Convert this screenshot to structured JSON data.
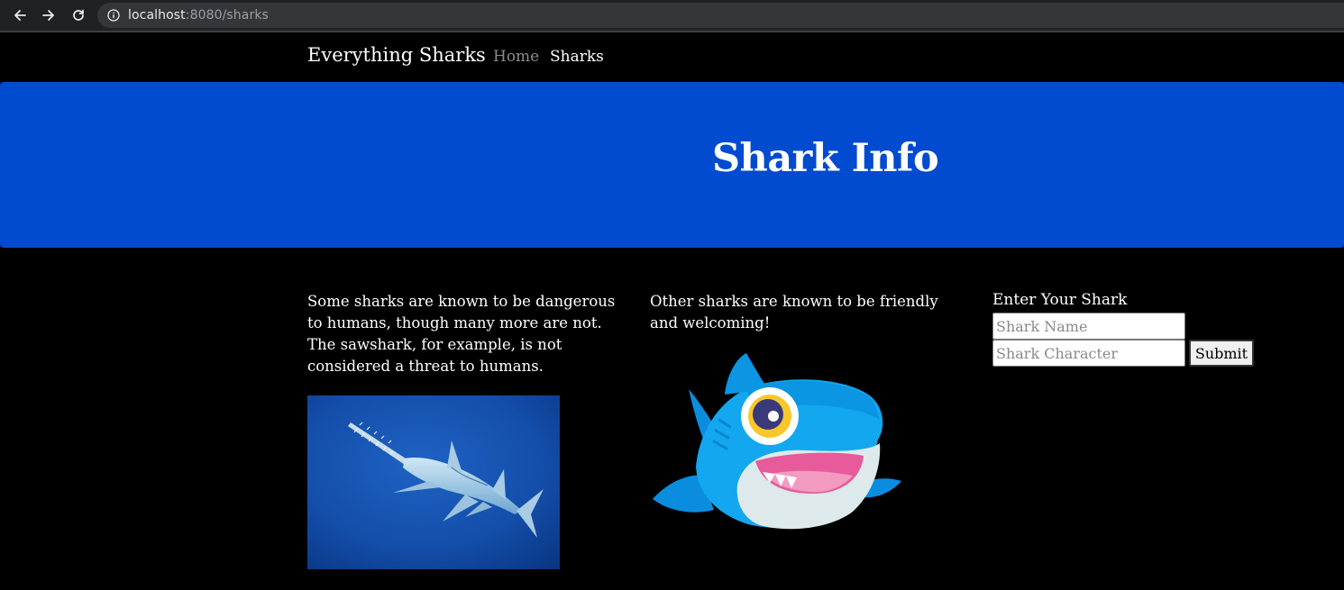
{
  "browser": {
    "url_host": "localhost",
    "url_path": ":8080/sharks"
  },
  "nav": {
    "brand": "Everything Sharks",
    "links": [
      "Home",
      "Sharks"
    ]
  },
  "hero": {
    "title": "Shark Info"
  },
  "content": {
    "col1_text": "Some sharks are known to be dangerous to humans, though many more are not. The sawshark, for example, is not considered a threat to humans.",
    "col2_text": "Other sharks are known to be friendly and welcoming!"
  },
  "form": {
    "title": "Enter Your Shark",
    "name_placeholder": "Shark Name",
    "character_placeholder": "Shark Character",
    "submit_label": "Submit"
  },
  "colors": {
    "hero_bg": "#004bd0",
    "page_bg": "#000000",
    "nav_inactive": "#8c8c8c"
  },
  "icons": [
    "back-arrow-icon",
    "forward-arrow-icon",
    "reload-icon",
    "info-icon"
  ]
}
